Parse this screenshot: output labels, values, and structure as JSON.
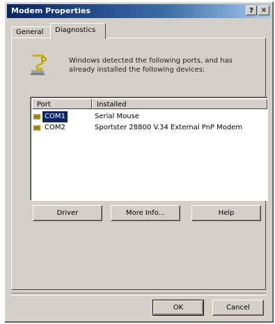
{
  "window": {
    "title": "Modem Properties"
  },
  "title_buttons": {
    "help_label": "?",
    "close_label": "✕"
  },
  "tabs": [
    {
      "label": "General",
      "active": false
    },
    {
      "label": "Diagnostics",
      "active": true
    }
  ],
  "diagnostics": {
    "info_text": "Windows detected the following ports, and has already installed the following devices:",
    "icon": "modem-info-icon",
    "columns": [
      "Port",
      "Installed"
    ],
    "rows": [
      {
        "port": "COM1",
        "installed": "Serial Mouse",
        "selected": true,
        "icon": "com-port-icon"
      },
      {
        "port": "COM2",
        "installed": "Sportster 28800 V.34 External PnP Modem",
        "selected": false,
        "icon": "com-port-icon"
      }
    ],
    "buttons": {
      "driver": "Driver",
      "more_info": "More Info...",
      "help": "Help"
    }
  },
  "footer": {
    "ok": "OK",
    "cancel": "Cancel"
  },
  "colors": {
    "title_bar": "#0a246a",
    "face": "#d4d0c8",
    "selection": "#0a246a"
  }
}
